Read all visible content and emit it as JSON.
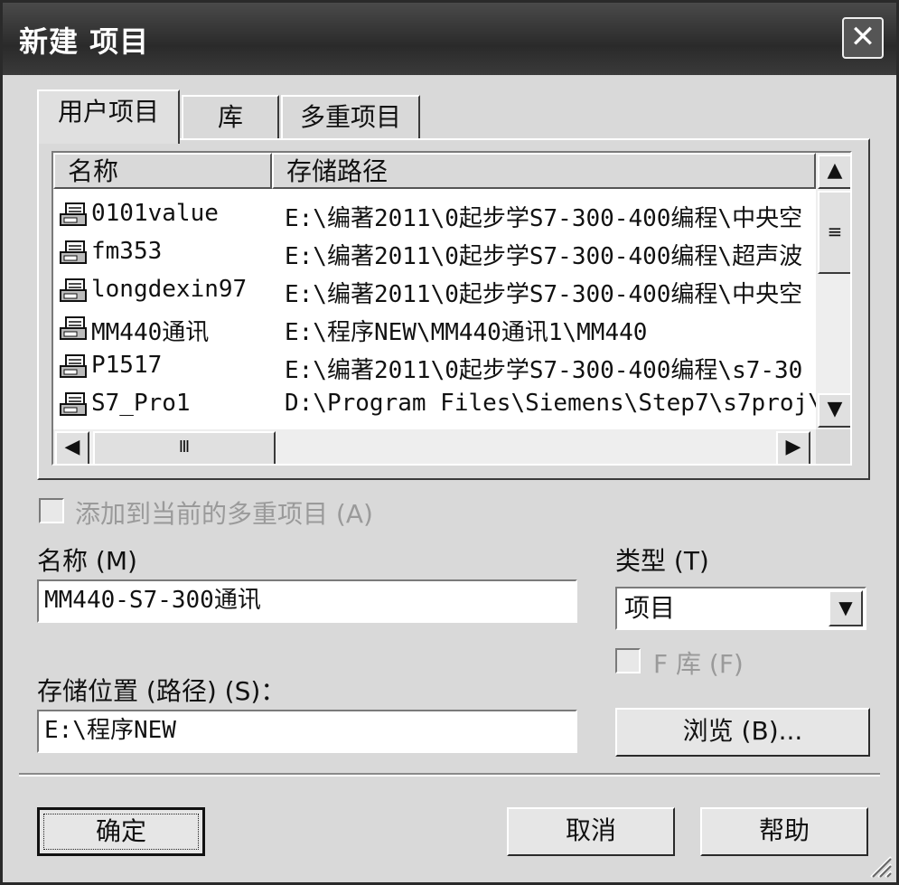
{
  "window": {
    "title": "新建 项目",
    "close_glyph": "✕"
  },
  "tabs": [
    {
      "label": "用户项目",
      "active": true
    },
    {
      "label": "库",
      "active": false
    },
    {
      "label": "多重项目",
      "active": false
    }
  ],
  "list": {
    "columns": [
      "名称",
      "存储路径"
    ],
    "rows": [
      {
        "name": "0101value",
        "path": "E:\\编著2011\\0起步学S7-300-400编程\\中央空",
        "icon": "project-icon"
      },
      {
        "name": "fm353",
        "path": "E:\\编著2011\\0起步学S7-300-400编程\\超声波",
        "icon": "project-icon"
      },
      {
        "name": "longdexin97",
        "path": "E:\\编著2011\\0起步学S7-300-400编程\\中央空",
        "icon": "project-icon"
      },
      {
        "name": "MM440通讯",
        "path": "E:\\程序NEW\\MM440通讯1\\MM440",
        "icon": "project-icon"
      },
      {
        "name": "P1517",
        "path": "E:\\编著2011\\0起步学S7-300-400编程\\s7-30",
        "icon": "project-icon"
      },
      {
        "name": "S7_Pro1",
        "path": "D:\\Program Files\\Siemens\\Step7\\s7proj\\S",
        "icon": "project-icon"
      }
    ],
    "scroll_up": "▲",
    "scroll_down": "▼",
    "scroll_left": "◀",
    "scroll_right": "▶",
    "grip_glyph": "≡",
    "hgrip_glyph": "Ⅲ"
  },
  "add_multiproject": {
    "label": "添加到当前的多重项目 (A)",
    "checked": false,
    "enabled": false
  },
  "name_field": {
    "label": "名称 (M)",
    "value": "MM440-S7-300通讯"
  },
  "type_field": {
    "label": "类型 (T)",
    "value": "项目",
    "arrow": "▼"
  },
  "f_library": {
    "label": "F 库 (F)",
    "checked": false,
    "enabled": false
  },
  "location_field": {
    "label": "存储位置 (路径) (S)：",
    "value": "E:\\程序NEW"
  },
  "buttons": {
    "browse": "浏览 (B)...",
    "ok": "确定",
    "cancel": "取消",
    "help": "帮助"
  }
}
